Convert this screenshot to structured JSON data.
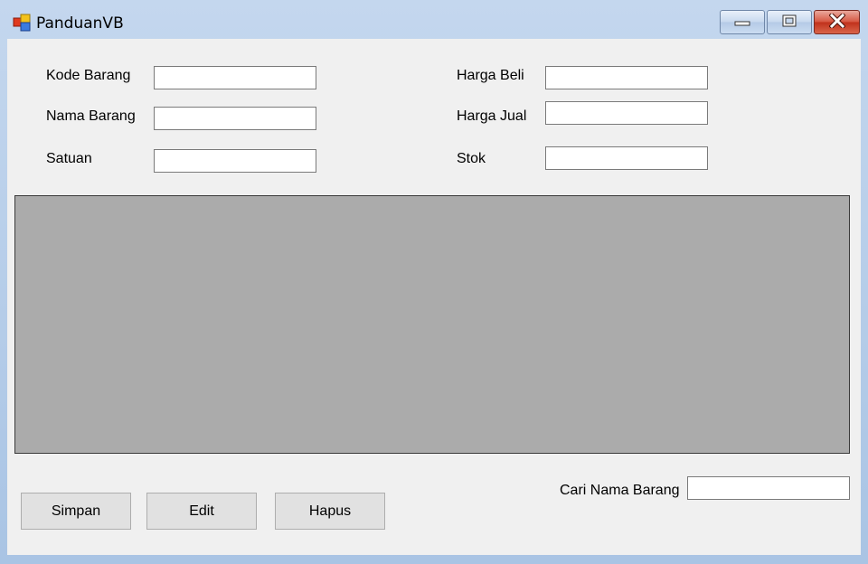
{
  "window": {
    "title": "PanduanVB",
    "icon": "windows-app-icon",
    "controls": {
      "minimize": "minimize-icon",
      "maximize": "maximize-icon",
      "close": "close-icon"
    }
  },
  "form": {
    "kode_barang": {
      "label": "Kode Barang",
      "value": ""
    },
    "nama_barang": {
      "label": "Nama Barang",
      "value": ""
    },
    "satuan": {
      "label": "Satuan",
      "value": ""
    },
    "harga_beli": {
      "label": "Harga Beli",
      "value": ""
    },
    "harga_jual": {
      "label": "Harga Jual",
      "value": ""
    },
    "stok": {
      "label": "Stok",
      "value": ""
    }
  },
  "buttons": {
    "simpan": "Simpan",
    "edit": "Edit",
    "hapus": "Hapus"
  },
  "search": {
    "label": "Cari Nama Barang",
    "value": ""
  },
  "colors": {
    "grid_background": "#ababab",
    "form_background": "#f0f0f0",
    "close_button": "#c7402a"
  }
}
